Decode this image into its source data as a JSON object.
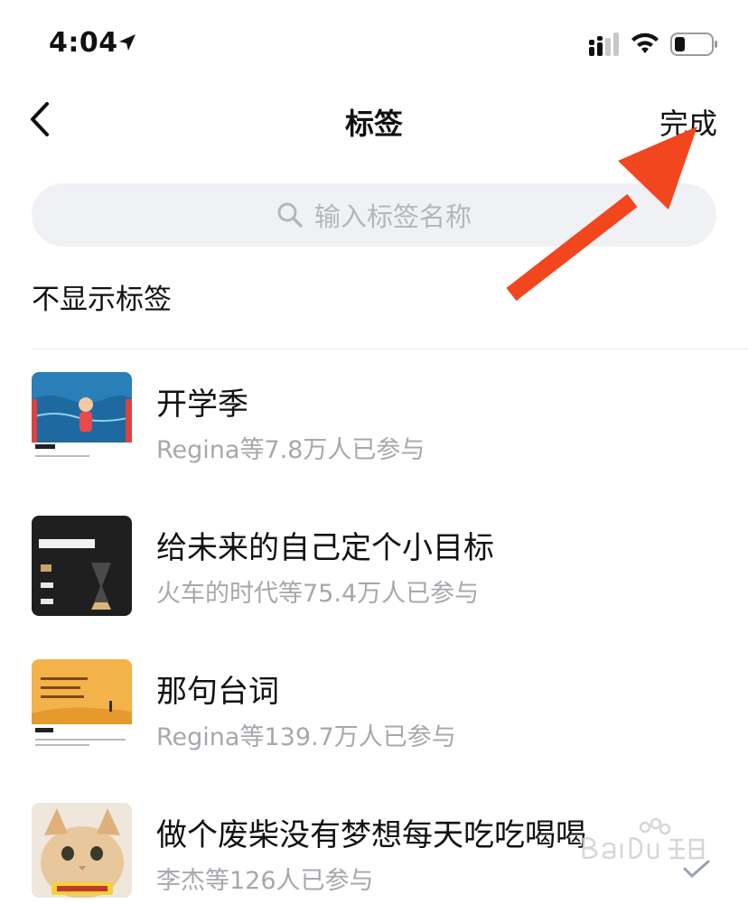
{
  "status_bar": {
    "time": "4:04",
    "icons": [
      "location-arrow-icon",
      "signal-icon",
      "wifi-icon",
      "battery-icon"
    ]
  },
  "nav": {
    "back_icon": "chevron-left-icon",
    "title": "标签",
    "done_label": "完成"
  },
  "search": {
    "placeholder": "输入标签名称",
    "icon": "search-icon"
  },
  "no_label_option": "不显示标签",
  "tags": [
    {
      "title": "开学季",
      "subtitle": "Regina等7.8万人已参与"
    },
    {
      "title": "给未来的自己定个小目标",
      "subtitle": "火车的时代等75.4万人已参与"
    },
    {
      "title": "那句台词",
      "subtitle": "Regina等139.7万人已参与"
    },
    {
      "title": "做个废柴没有梦想每天吃吃喝喝",
      "subtitle": "李杰等126人已参与"
    }
  ],
  "colors": {
    "annotation_arrow": "#f2461e",
    "search_bg": "#f0f1f4",
    "secondary_text": "#a6a8ae"
  }
}
